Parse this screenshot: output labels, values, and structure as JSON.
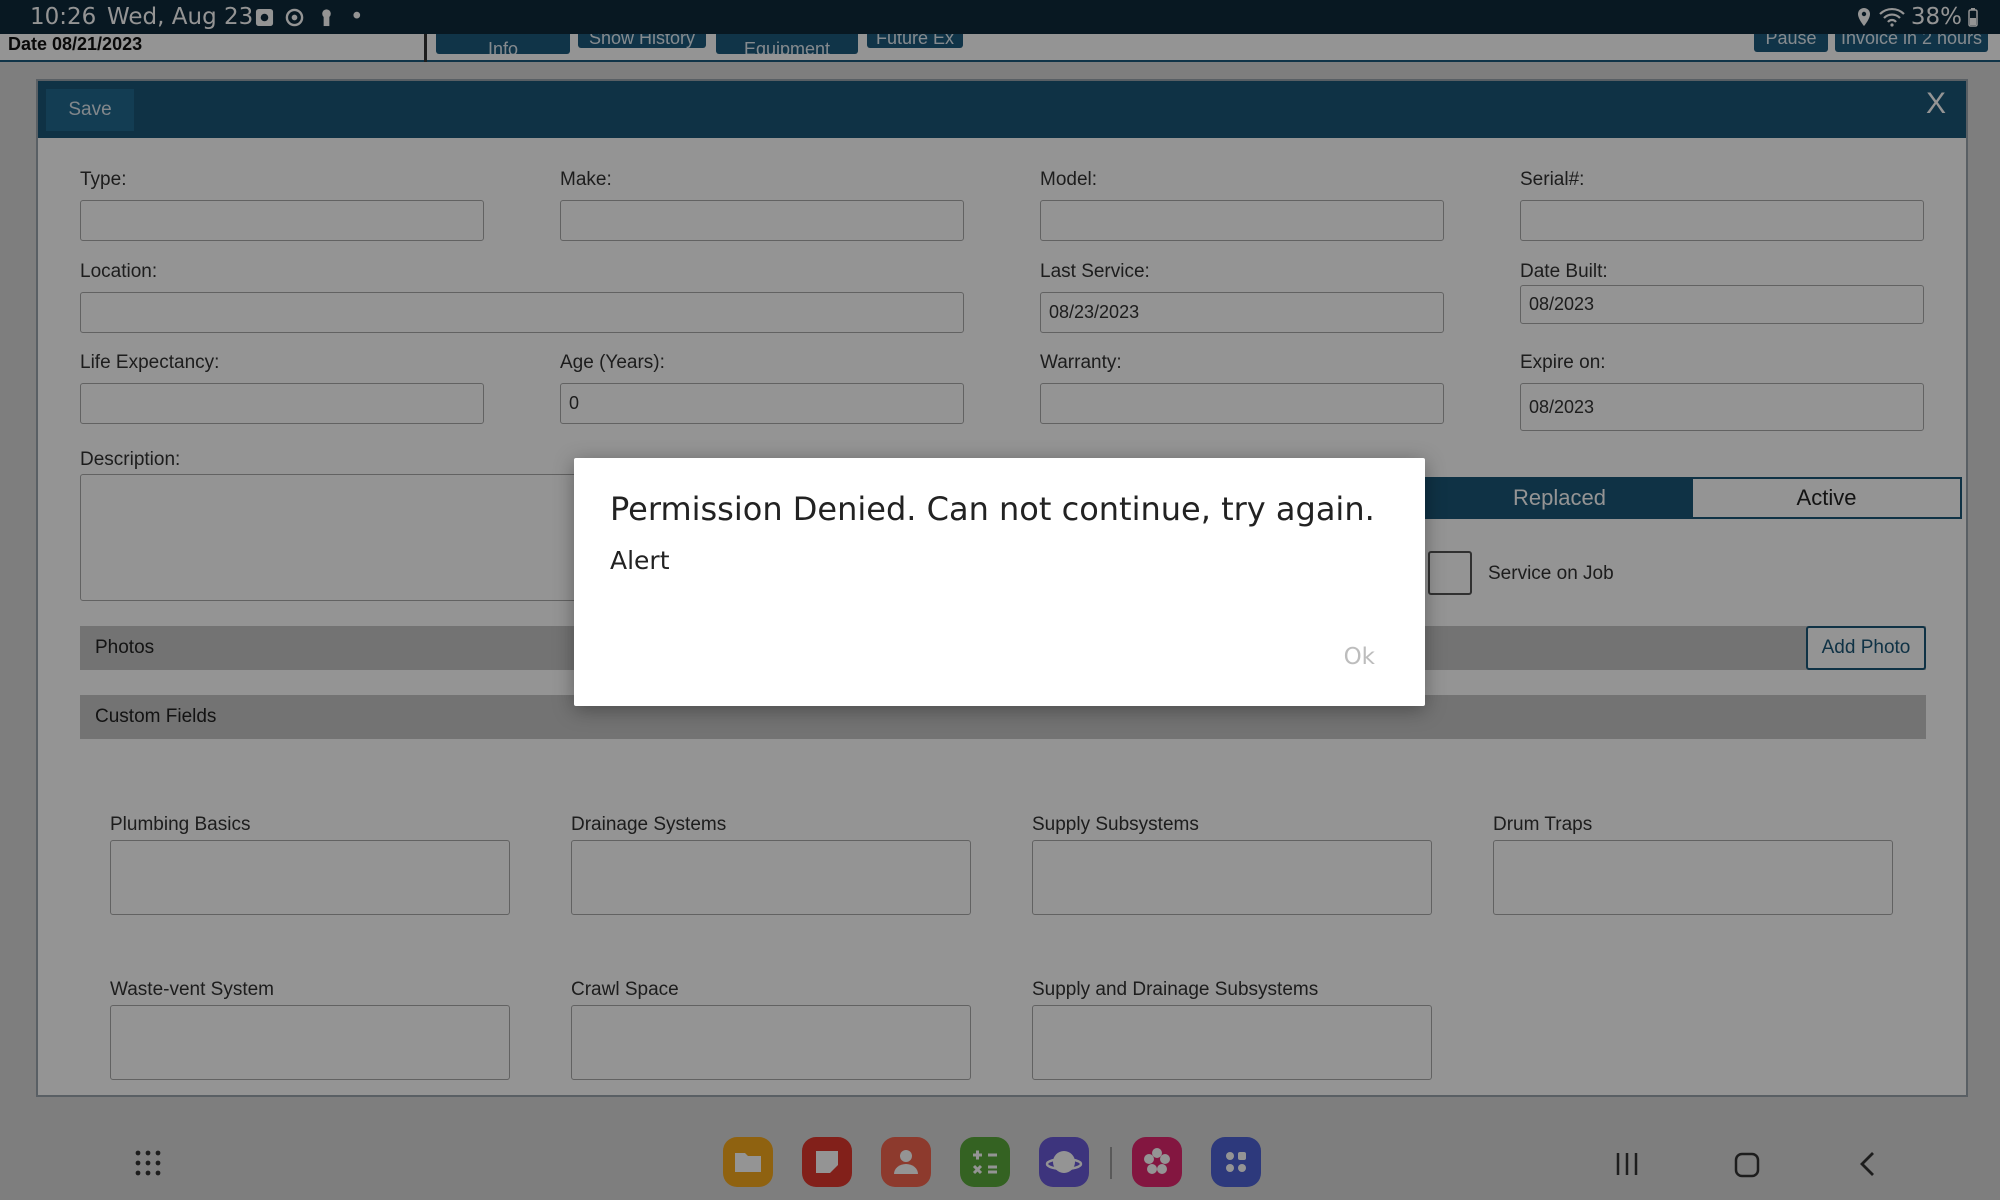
{
  "status_bar": {
    "time": "10:26",
    "date": "Wed, Aug 23",
    "dot": "•",
    "battery": "38%"
  },
  "app_header": {
    "date_label": "Date 08/21/2023",
    "tabs": [
      "Info",
      "Show History",
      "Equipment",
      "Future Ex"
    ],
    "right_tabs": [
      "Pause",
      "Invoice in 2 hours"
    ]
  },
  "panel": {
    "save_label": "Save",
    "close_label": "X",
    "fields": {
      "type": {
        "label": "Type:",
        "value": ""
      },
      "make": {
        "label": "Make:",
        "value": ""
      },
      "model": {
        "label": "Model:",
        "value": ""
      },
      "serial": {
        "label": "Serial#:",
        "value": ""
      },
      "location": {
        "label": "Location:",
        "value": ""
      },
      "last_service": {
        "label": "Last Service:",
        "value": "08/23/2023"
      },
      "date_built": {
        "label": "Date Built:",
        "value": "08/2023"
      },
      "life_expectancy": {
        "label": "Life Expectancy:",
        "value": ""
      },
      "age": {
        "label": "Age (Years):",
        "value": "0"
      },
      "warranty": {
        "label": "Warranty:",
        "value": ""
      },
      "expire_on": {
        "label": "Expire on:",
        "value": "08/2023"
      },
      "description": {
        "label": "Description:",
        "value": ""
      }
    },
    "status_toggle": {
      "replaced": "Replaced",
      "active": "Active"
    },
    "service_on_job": "Service on Job",
    "photos_label": "Photos",
    "add_photo_label": "Add Photo",
    "custom_fields_label": "Custom Fields",
    "custom_fields": [
      "Plumbing Basics",
      "Drainage Systems",
      "Supply Subsystems",
      "Drum Traps",
      "Waste-vent System",
      "Crawl Space",
      "Supply and Drainage Subsystems"
    ]
  },
  "dialog": {
    "title": "Permission Denied. Can not continue, try again.",
    "message": "Alert",
    "ok_label": "Ok"
  },
  "colors": {
    "header": "#1a5677",
    "statusbar": "#0f2a3c",
    "dock": [
      "#f7a91d",
      "#e0382e",
      "#f3654e",
      "#5ba93c",
      "#6a5ad8",
      "#e2266f",
      "#4e63d6"
    ]
  }
}
